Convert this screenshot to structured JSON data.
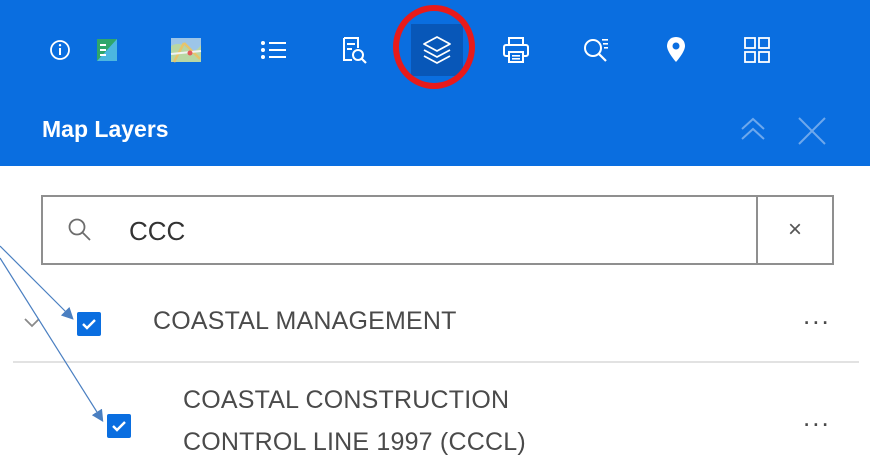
{
  "toolbar": {
    "tools": [
      {
        "name": "about-tool",
        "icon": "info-icon"
      },
      {
        "name": "legend-tool",
        "icon": "legend-icon"
      },
      {
        "name": "basemap-tool",
        "icon": "basemap-icon"
      },
      {
        "name": "list-tool",
        "icon": "list-icon"
      },
      {
        "name": "query-tool",
        "icon": "query-icon"
      },
      {
        "name": "layers-tool",
        "icon": "layers-icon",
        "active": true
      },
      {
        "name": "print-tool",
        "icon": "print-icon"
      },
      {
        "name": "search-tool",
        "icon": "search-icon"
      },
      {
        "name": "location-tool",
        "icon": "location-pin-icon"
      },
      {
        "name": "widgets-tool",
        "icon": "grid-icon"
      }
    ],
    "accent": "#0a6ee0",
    "highlight_color": "#e81a1a"
  },
  "panel": {
    "title": "Map Layers",
    "collapse_icon": "double-chevron-up-icon",
    "close_icon": "close-icon"
  },
  "search": {
    "value": "CCC",
    "clear_label": "×"
  },
  "layers": [
    {
      "label": "COASTAL MANAGEMENT",
      "checked": true,
      "expanded": true,
      "more_label": "..."
    },
    {
      "label_line1": "COASTAL CONSTRUCTION",
      "label_line2": "CONTROL LINE 1997 (CCCL)",
      "checked": true,
      "more_label": "..."
    }
  ]
}
